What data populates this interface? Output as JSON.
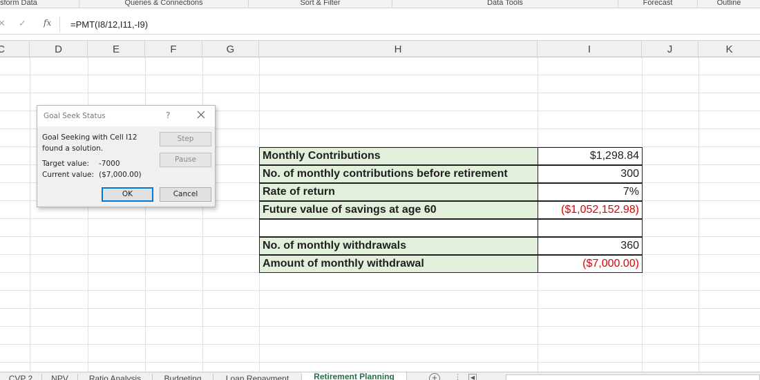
{
  "ribbon": {
    "groups": [
      "sform Data",
      "Queries & Connections",
      "Sort & Filter",
      "Data Tools",
      "Forecast",
      "Outline"
    ]
  },
  "formula_bar": {
    "cancel_symbol": "✕",
    "enter_symbol": "✓",
    "fx_label": "fx",
    "formula": "=PMT(I8/12,I11,-I9)"
  },
  "columns": [
    "C",
    "D",
    "E",
    "F",
    "G",
    "H",
    "I",
    "J",
    "K"
  ],
  "table": {
    "rows": [
      {
        "label": "Monthly Contributions",
        "value": "$1,298.84"
      },
      {
        "label": "No. of monthly contributions before retirement",
        "value": "300"
      },
      {
        "label": "Rate of return",
        "value": "7%"
      },
      {
        "label": "Future value of savings at age 60",
        "value": "($1,052,152.98)"
      },
      {
        "label": "",
        "value": ""
      },
      {
        "label": "No. of monthly withdrawals",
        "value": "360"
      },
      {
        "label": "Amount of monthly withdrawal",
        "value": "($7,000.00)"
      }
    ]
  },
  "dialog": {
    "title": "Goal Seek Status",
    "help": "?",
    "message_line1": "Goal Seeking with Cell I12",
    "message_line2": "found a solution.",
    "target_label": "Target value:",
    "target_value": "-7000",
    "current_label": "Current value:",
    "current_value": "($7,000.00)",
    "step_label": "Step",
    "pause_label": "Pause",
    "ok_label": "OK",
    "cancel_label": "Cancel"
  },
  "sheet_tabs": {
    "tabs": [
      "CVP 2",
      "NPV",
      "Ratio Analysis",
      "Budgeting",
      "Loan Repayment",
      "Retirement Planning"
    ],
    "active": "Retirement Planning",
    "add_symbol": "+",
    "more_symbol": "⋮",
    "scroll_left_symbol": "◀"
  },
  "colors": {
    "label_fill": "#e2efda",
    "negative_text": "#e00000",
    "active_tab": "#217346"
  }
}
